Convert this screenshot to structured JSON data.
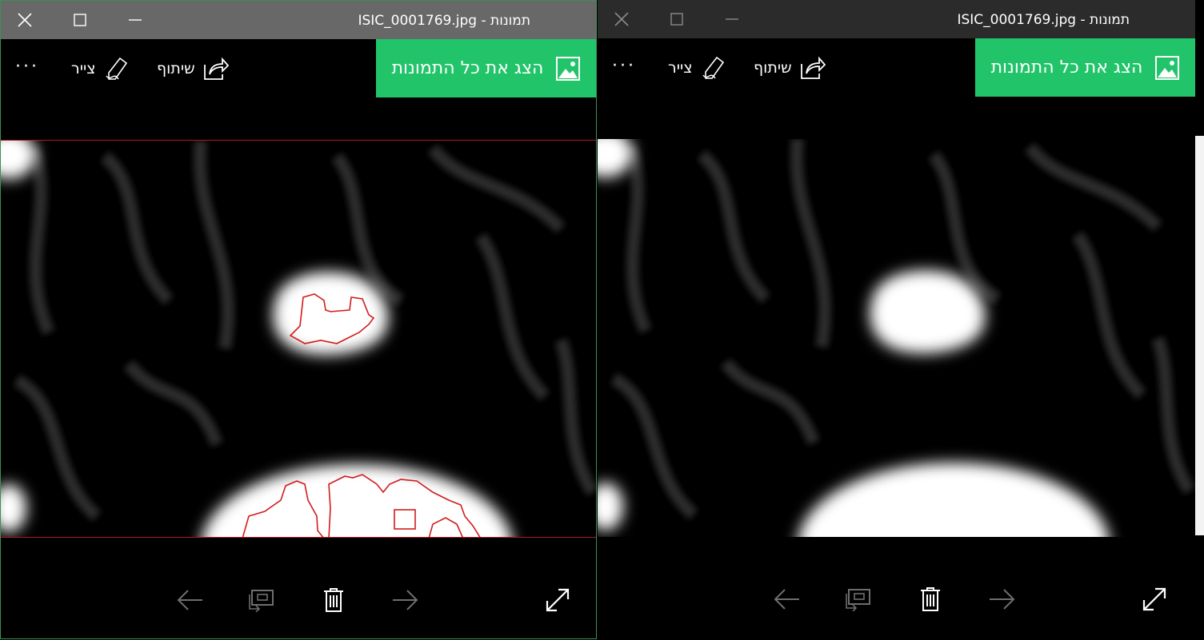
{
  "windows": [
    {
      "title": "ISIC_0001769.jpg - תמונות",
      "toolbar": {
        "more_label": "···",
        "draw_label": "צייר",
        "share_label": "שיתוף",
        "show_all_label": "הצג את כל התמונות"
      },
      "overlay_contours": true
    },
    {
      "title": "ISIC_0001769.jpg - תמונות",
      "toolbar": {
        "more_label": "···",
        "draw_label": "צייר",
        "share_label": "שיתוף",
        "show_all_label": "הצג את כל התמונות"
      },
      "overlay_contours": false
    }
  ],
  "icons": {
    "close": "close-icon",
    "maximize": "maximize-icon",
    "minimize": "minimize-icon",
    "draw": "pen-icon",
    "share": "share-icon",
    "show_all": "image-icon",
    "prev": "arrow-left-icon",
    "slideshow": "slideshow-icon",
    "delete": "trash-icon",
    "next": "arrow-right-icon",
    "fullscreen": "fullscreen-icon"
  },
  "colors": {
    "accent": "#22c46a",
    "contour": "#d41a1a",
    "left_titlebar": "#686868",
    "right_titlebar": "#2b2b2b"
  }
}
